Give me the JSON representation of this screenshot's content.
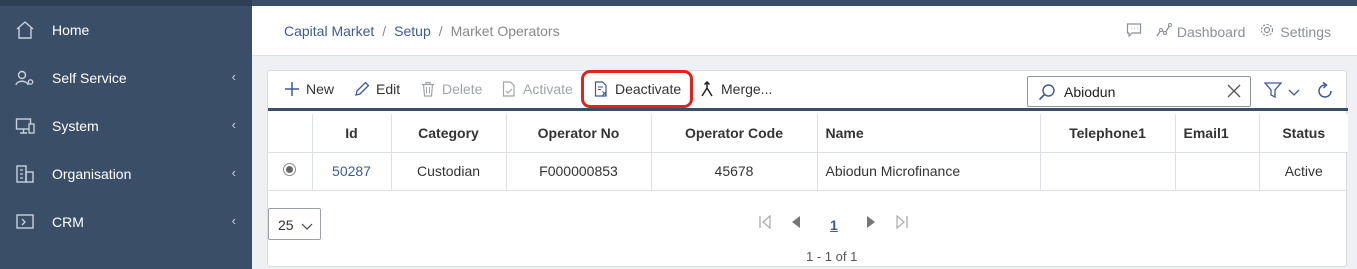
{
  "sidebar": {
    "items": [
      {
        "label": "Home",
        "icon": "home-icon",
        "has_children": false
      },
      {
        "label": "Self Service",
        "icon": "user-settings-icon",
        "has_children": true
      },
      {
        "label": "System",
        "icon": "monitor-icon",
        "has_children": true
      },
      {
        "label": "Organisation",
        "icon": "building-icon",
        "has_children": true
      },
      {
        "label": "CRM",
        "icon": "crm-icon",
        "has_children": true
      }
    ],
    "chevron": "‹",
    "colors": {
      "bg": "#3b4e68",
      "text": "#ffffff"
    }
  },
  "breadcrumb": {
    "items": [
      "Capital Market",
      "Setup",
      "Market Operators"
    ],
    "separator": "/"
  },
  "topbar": {
    "dashboard_label": "Dashboard",
    "settings_label": "Settings"
  },
  "toolbar": {
    "new_label": "New",
    "edit_label": "Edit",
    "delete_label": "Delete",
    "activate_label": "Activate",
    "deactivate_label": "Deactivate",
    "merge_label": "Merge...",
    "highlight_color": "#e3221b"
  },
  "search": {
    "value": "Abiodun"
  },
  "table": {
    "columns": [
      "Id",
      "Category",
      "Operator No",
      "Operator Code",
      "Name",
      "Telephone1",
      "Email1",
      "Status"
    ],
    "rows": [
      {
        "id": "50287",
        "category": "Custodian",
        "operator_no": "F000000853",
        "operator_code": "45678",
        "name": "Abiodun Microfinance",
        "telephone1": "",
        "email1": "",
        "status": "Active",
        "selected": true
      }
    ]
  },
  "pager": {
    "page_size": "25",
    "current_page": "1",
    "info": "1 - 1 of 1"
  },
  "accent_color": "#3c5a9a"
}
